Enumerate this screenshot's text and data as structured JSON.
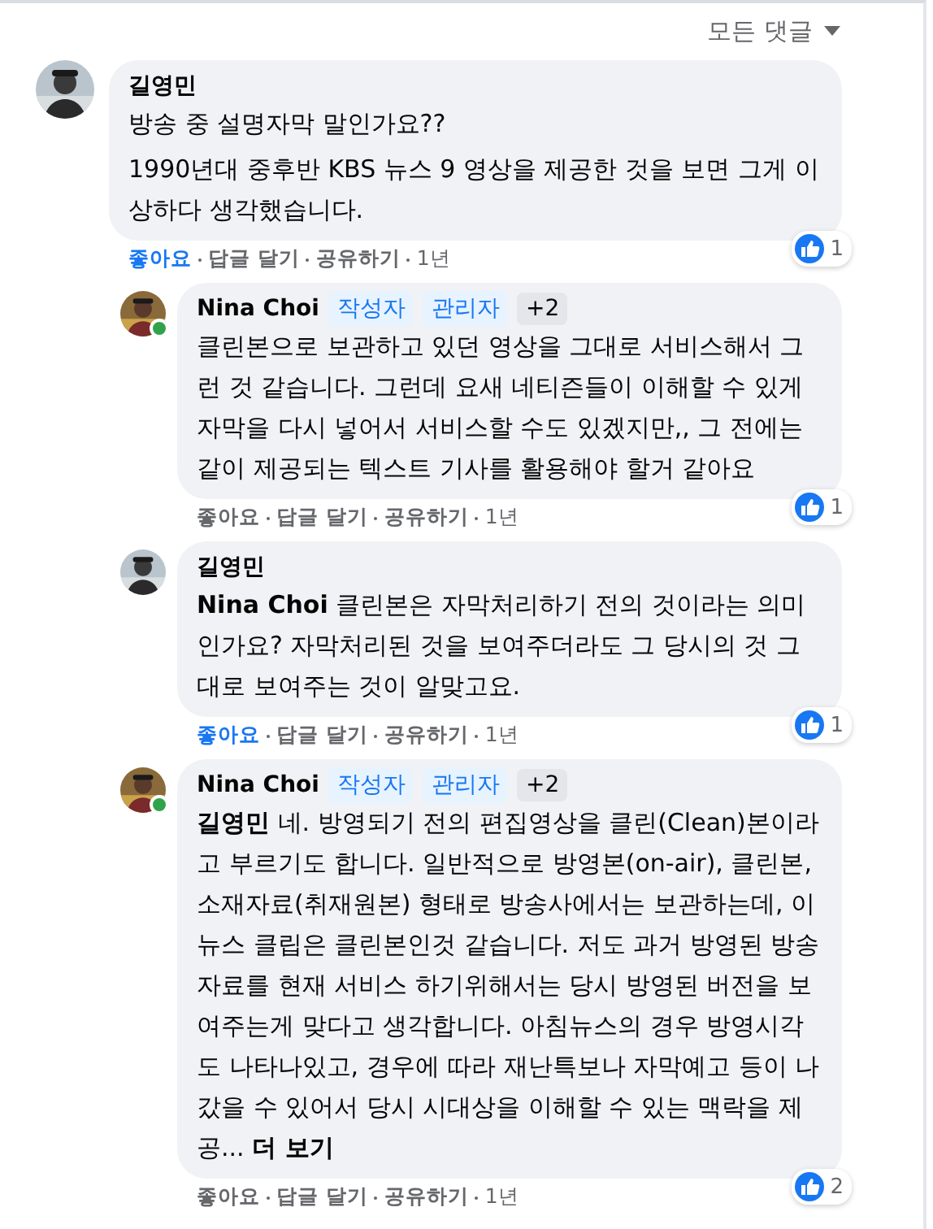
{
  "sort": {
    "label": "모든 댓글"
  },
  "comments": [
    {
      "kind": "comment",
      "author": "길영민",
      "online": false,
      "paragraphs": [
        "방송 중 설명자막 말인가요??",
        "1990년대 중후반 KBS 뉴스 9 영상을 제공한 것을 보면 그게 이상하다 생각했습니다."
      ],
      "actions": [
        "좋아요",
        "답글 달기",
        "공유하기"
      ],
      "liked": true,
      "time": "1년",
      "reaction_count": "1"
    },
    {
      "kind": "reply",
      "author": "Nina Choi",
      "badges": [
        {
          "label": "작성자",
          "kind": "role"
        },
        {
          "label": "관리자",
          "kind": "role"
        },
        {
          "label": "+2",
          "kind": "more"
        }
      ],
      "online": true,
      "paragraphs": [
        "클린본으로 보관하고 있던 영상을 그대로 서비스해서 그런 것 같습니다. 그런데 요새 네티즌들이 이해할 수 있게 자막을 다시 넣어서 서비스할 수도 있겠지만,, 그 전에는 같이 제공되는 텍스트 기사를 활용해야 할거 같아요"
      ],
      "actions": [
        "좋아요",
        "답글 달기",
        "공유하기"
      ],
      "liked": false,
      "time": "1년",
      "reaction_count": "1"
    },
    {
      "kind": "reply",
      "author": "길영민",
      "online": false,
      "paragraphs": [
        "**Nina Choi** 클린본은 자막처리하기 전의 것이라는 의미인가요? 자막처리된 것을 보여주더라도 그 당시의 것 그대로 보여주는 것이 알맞고요."
      ],
      "actions": [
        "좋아요",
        "답글 달기",
        "공유하기"
      ],
      "liked": true,
      "time": "1년",
      "reaction_count": "1"
    },
    {
      "kind": "reply",
      "author": "Nina Choi",
      "badges": [
        {
          "label": "작성자",
          "kind": "role"
        },
        {
          "label": "관리자",
          "kind": "role"
        },
        {
          "label": "+2",
          "kind": "more"
        }
      ],
      "online": true,
      "paragraphs": [
        "**길영민** 네. 방영되기 전의 편집영상을 클린(Clean)본이라고 부르기도 합니다. 일반적으로 방영본(on-air), 클린본, 소재자료(취재원본) 형태로 방송사에서는 보관하는데, 이뉴스 클립은 클린본인것 같습니다. 저도 과거 방영된 방송자료를 현재 서비스 하기위해서는 당시 방영된 버전을 보여주는게 맞다고 생각합니다. 아침뉴스의 경우 방영시각도 나타나있고, 경우에 따라 재난특보나 자막예고 등이 나갔을 수 있어서 당시 시대상을 이해할 수 있는 맥락을 제공..."
      ],
      "more": "더 보기",
      "actions": [
        "좋아요",
        "답글 달기",
        "공유하기"
      ],
      "liked": false,
      "time": "1년",
      "reaction_count": "2"
    }
  ]
}
